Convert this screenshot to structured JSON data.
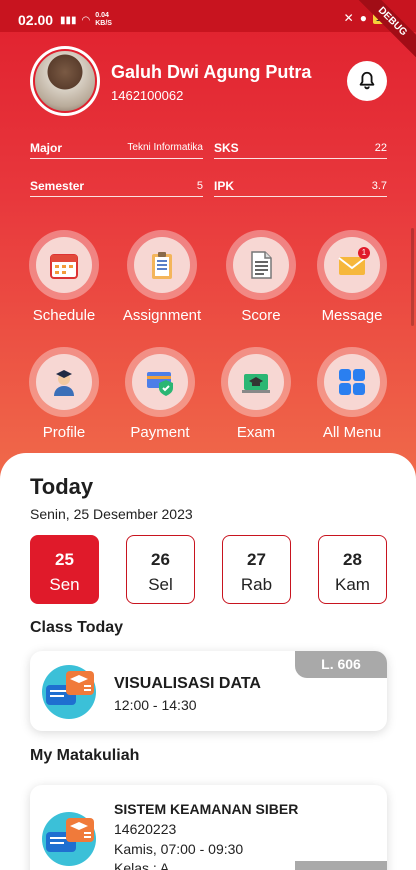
{
  "status": {
    "time": "02.00",
    "net_speed_top": "0.04",
    "net_speed_unit": "KB/S",
    "battery": "100",
    "debug": "DEBUG"
  },
  "profile": {
    "name": "Galuh Dwi Agung Putra",
    "id": "1462100062"
  },
  "info": {
    "major_label": "Major",
    "major_value": "Tekni Informatika",
    "sks_label": "SKS",
    "sks_value": "22",
    "semester_label": "Semester",
    "semester_value": "5",
    "ipk_label": "IPK",
    "ipk_value": "3.7"
  },
  "menu": [
    {
      "label": "Schedule",
      "icon": "calendar-icon"
    },
    {
      "label": "Assignment",
      "icon": "clipboard-icon"
    },
    {
      "label": "Score",
      "icon": "document-icon"
    },
    {
      "label": "Message",
      "icon": "envelope-icon",
      "badge": "1"
    },
    {
      "label": "Profile",
      "icon": "graduate-icon"
    },
    {
      "label": "Payment",
      "icon": "payment-icon"
    },
    {
      "label": "Exam",
      "icon": "exam-icon"
    },
    {
      "label": "All Menu",
      "icon": "grid-icon"
    }
  ],
  "today": {
    "title": "Today",
    "date": "Senin, 25 Desember 2023"
  },
  "days": [
    {
      "num": "25",
      "name": "Sen",
      "active": true
    },
    {
      "num": "26",
      "name": "Sel",
      "active": false
    },
    {
      "num": "27",
      "name": "Rab",
      "active": false
    },
    {
      "num": "28",
      "name": "Kam",
      "active": false
    }
  ],
  "class_today": {
    "title": "Class Today",
    "course": "VISUALISASI DATA",
    "time": "12:00 - 14:30",
    "room": "L. 606"
  },
  "matakuliah": {
    "title": "My Matakuliah",
    "course": "SISTEM KEAMANAN SIBER",
    "code": "14620223",
    "schedule": "Kamis, 07:00 - 09:30",
    "class": "Kelas : A"
  },
  "colors": {
    "primary": "#e01a2a",
    "gradient_end": "#f06a4a",
    "badge_grey": "#a9a9a9"
  }
}
